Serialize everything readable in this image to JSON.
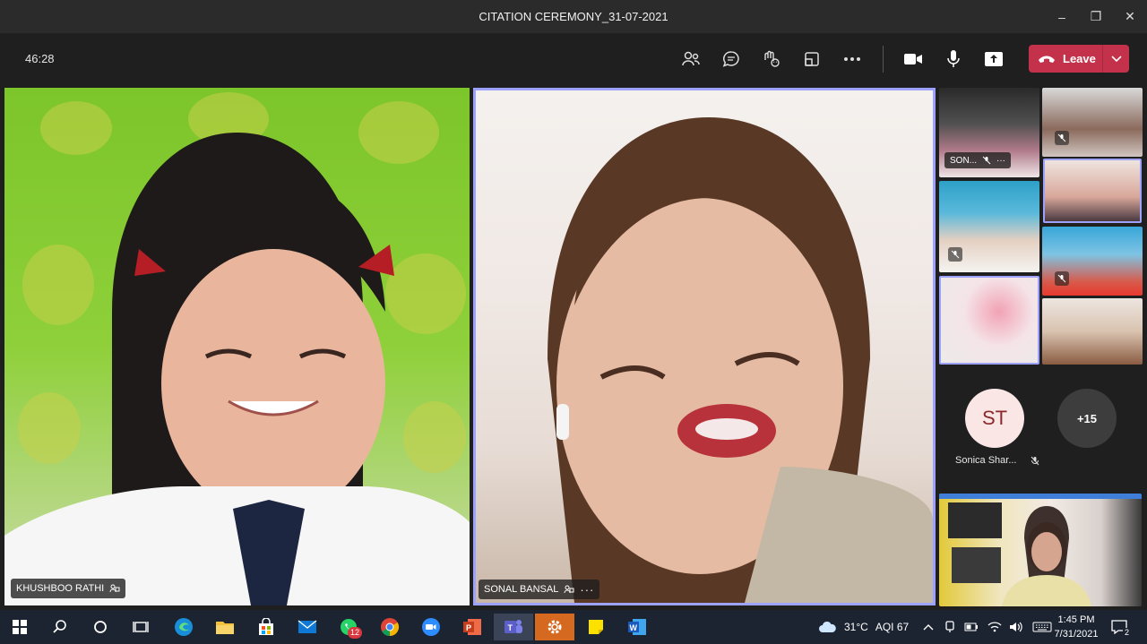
{
  "window": {
    "title": "CITATION CEREMONY_31-07-2021",
    "minimize": "–",
    "maximize": "❐",
    "close": "✕"
  },
  "meeting": {
    "timer": "46:28",
    "leave_label": "Leave"
  },
  "participants": {
    "main": [
      {
        "name": "KHUSHBOO RATHI"
      },
      {
        "name": "SONAL BANSAL"
      }
    ],
    "thumb_label": "SON...",
    "avatar": {
      "initials": "ST",
      "name": "Sonica Shar..."
    },
    "overflow_count": "+15"
  },
  "taskbar": {
    "whatsapp_badge": "12",
    "weather": "31°C",
    "aqi": "AQI 67",
    "time": "1:45 PM",
    "date": "7/31/2021",
    "notifications": "2"
  },
  "colors": {
    "leave": "#c4314b",
    "active_border": "#9ea2ff",
    "teams_purple": "#5b5fc7"
  }
}
